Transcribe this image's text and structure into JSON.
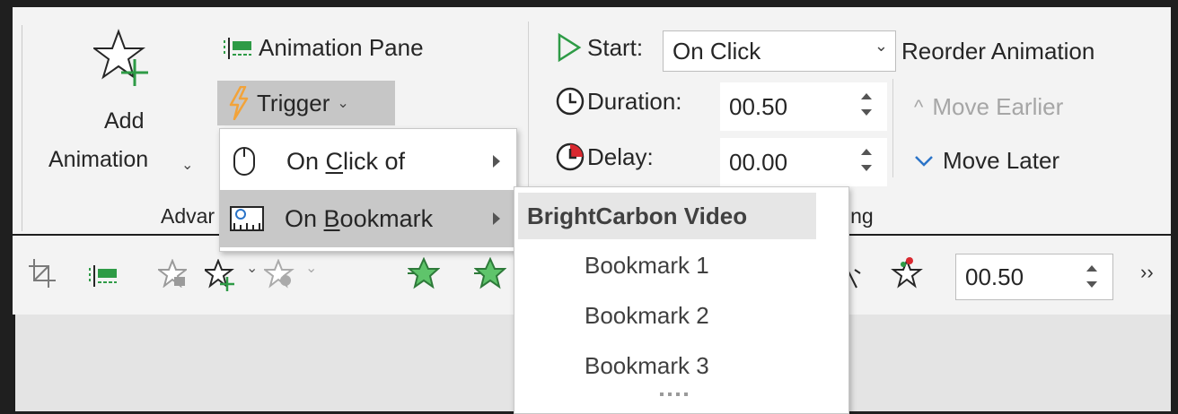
{
  "advanced": {
    "add_animation_line1": "Add",
    "add_animation_line2": "Animation",
    "animation_pane": "Animation Pane",
    "trigger": "Trigger",
    "group_label_partial": "Advar"
  },
  "timing": {
    "start_label": "Start:",
    "start_value": "On Click",
    "duration_label": "Duration:",
    "duration_value": "00.50",
    "delay_label": "Delay:",
    "delay_value": "00.00",
    "group_label_partial": "ing",
    "reorder_title": "Reorder Animation",
    "move_earlier": "Move Earlier",
    "move_later": "Move Later"
  },
  "trigger_menu": {
    "on_click_of_pre": "On ",
    "on_click_of_u": "C",
    "on_click_of_post": "lick of",
    "on_bookmark_pre": "On ",
    "on_bookmark_u": "B",
    "on_bookmark_post": "ookmark"
  },
  "bookmark_menu": {
    "header": "BrightCarbon Video",
    "items": [
      "Bookmark 1",
      "Bookmark 2",
      "Bookmark 3"
    ]
  },
  "toolbar": {
    "duration_value": "00.50",
    "overflow": "››"
  },
  "icons": {
    "add_animation": "star-plus-icon",
    "animation_pane": "animation-pane-icon",
    "trigger": "lightning-icon",
    "start": "play-triangle-icon",
    "duration": "clock-icon",
    "delay": "delay-clock-icon",
    "mouse": "mouse-icon",
    "bookmark": "bookmark-ruler-icon"
  },
  "colors": {
    "accent_green": "#2e9b46",
    "trigger_orange": "#f2a33a",
    "delay_red": "#d9282f",
    "move_later_blue": "#2b74c8"
  }
}
